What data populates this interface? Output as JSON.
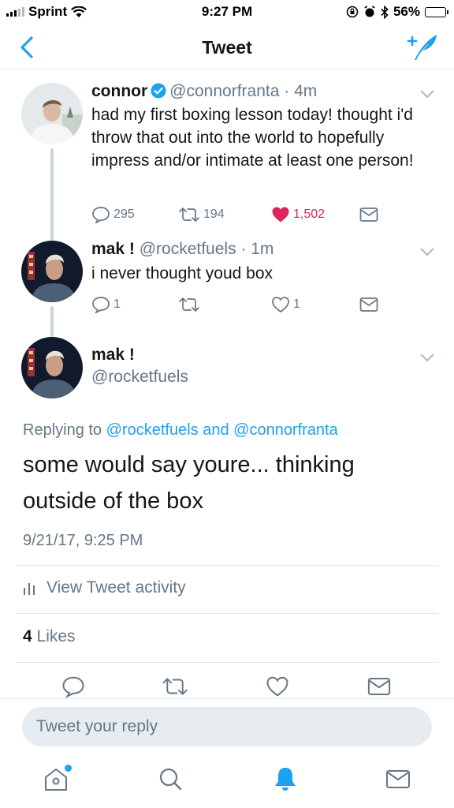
{
  "status_bar": {
    "carrier": "Sprint",
    "time": "9:27 PM",
    "battery": "56%",
    "battery_level": 0.56,
    "icons": [
      "signal-icon",
      "wifi-icon",
      "lock-rotation-icon",
      "alarm-icon",
      "bluetooth-icon",
      "battery-icon"
    ]
  },
  "nav": {
    "title": "Tweet",
    "back_icon": "chevron-left-icon",
    "compose_icon": "compose-tweet-icon"
  },
  "tweets": [
    {
      "name": "connor",
      "verified": true,
      "handle": "@connorfranta",
      "time": "· 4m",
      "text": "had my first boxing lesson today! thought i'd throw that out into the world to hopefully impress and/or intimate at least one person!",
      "replies": "295",
      "retweets": "194",
      "likes": "1,502",
      "liked": true
    },
    {
      "name": "mak !",
      "handle": "@rocketfuels",
      "time": "· 1m",
      "text": "i never thought youd box",
      "replies": "1",
      "retweets": "",
      "likes": "1",
      "liked": false
    }
  ],
  "main_tweet": {
    "name": "mak !",
    "handle": "@rocketfuels",
    "replying_prefix": "Replying to",
    "replying_user1": "@rocketfuels",
    "replying_and": "and",
    "replying_user2": "@connorfranta",
    "text_line1": "some would say youre... thinking",
    "text_line2": "outside of the box",
    "date": "9/21/17, 9:25 PM",
    "activity_label": "View Tweet activity",
    "likes_count": "4",
    "likes_label": "Likes"
  },
  "reply_bar": {
    "placeholder": "Tweet your reply"
  },
  "tab_bar": {
    "items": [
      "home-icon",
      "search-icon",
      "notifications-icon",
      "messages-icon"
    ],
    "active": "notifications-icon",
    "accent": "#1da1f2"
  },
  "colors": {
    "accent": "#1da1f2",
    "like": "#e0245e",
    "secondary_text": "#657786"
  }
}
